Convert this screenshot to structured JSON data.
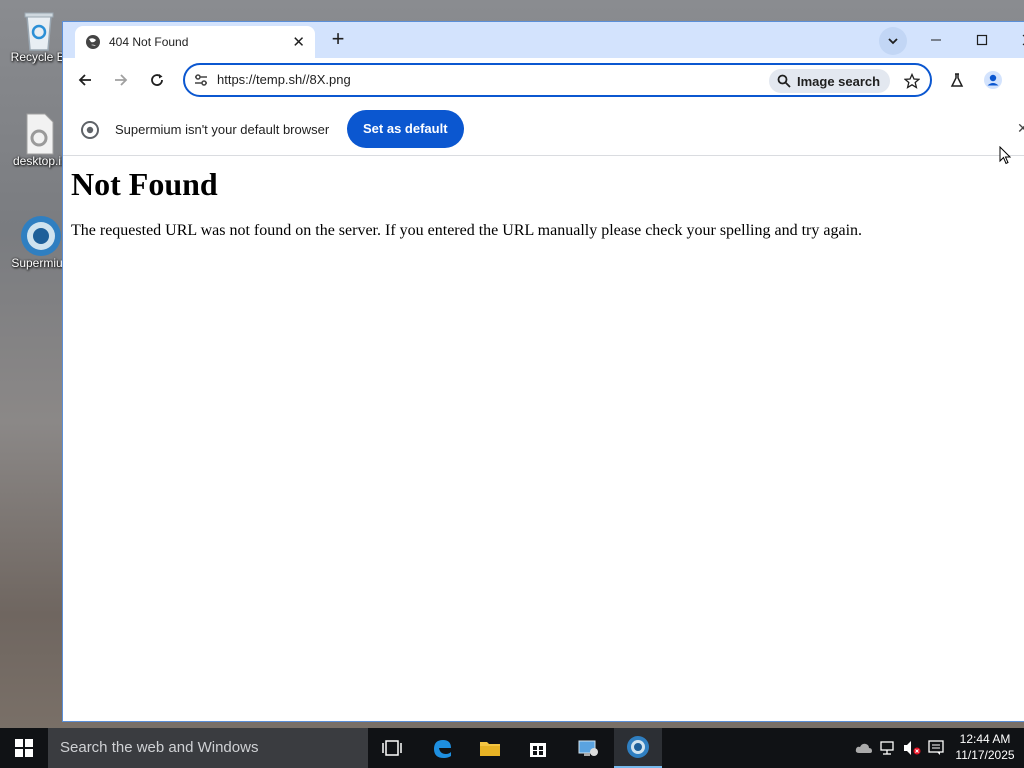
{
  "desktop": {
    "icons": [
      {
        "label": "Recycle Bi"
      },
      {
        "label": "desktop.ir"
      },
      {
        "label": "Supermiur"
      }
    ]
  },
  "browser": {
    "tab": {
      "title": "404 Not Found"
    },
    "omnibox": {
      "url": "https://temp.sh/​/8X.png",
      "image_search_label": "Image search"
    },
    "infobar": {
      "message": "Supermium isn't your default browser",
      "button_label": "Set as default"
    }
  },
  "page": {
    "heading": "Not Found",
    "body": "The requested URL was not found on the server. If you entered the URL manually please check your spelling and try again."
  },
  "taskbar": {
    "search_placeholder": "Search the web and Windows",
    "clock_time": "12:44 AM",
    "clock_date": "11/17/2025"
  },
  "colors": {
    "accent": "#0b57d0",
    "tabstrip": "#d3e3fd",
    "taskbar": "#101215"
  }
}
